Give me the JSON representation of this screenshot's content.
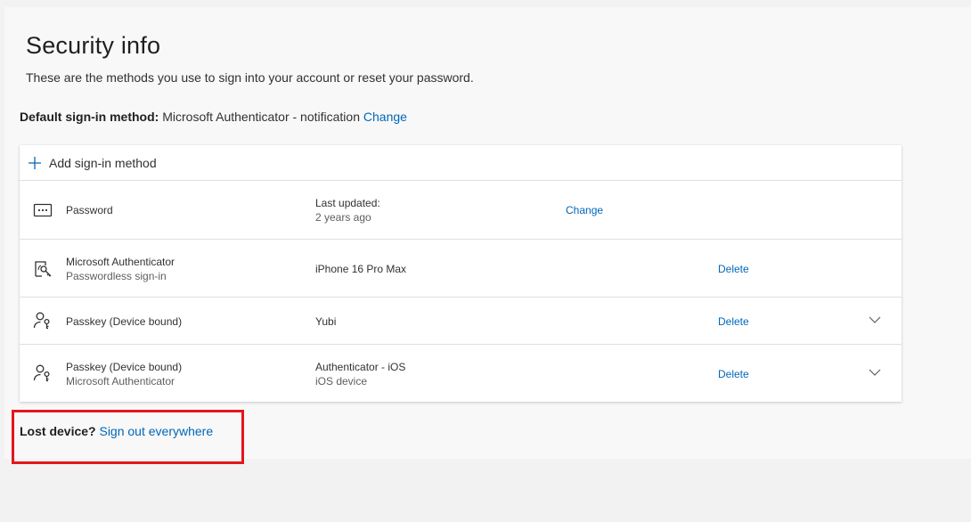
{
  "header": {
    "title": "Security info",
    "subtitle": "These are the methods you use to sign into your account or reset your password."
  },
  "default_method": {
    "label": "Default sign-in method:",
    "value": "Microsoft Authenticator - notification",
    "change_label": "Change"
  },
  "add_method": {
    "label": "Add sign-in method",
    "icon": "plus-icon"
  },
  "methods": [
    {
      "icon": "password-icon",
      "name": "Password",
      "name_sub": "",
      "detail": "Last updated:",
      "detail_sub": "2 years ago",
      "action": "Change",
      "expandable": false
    },
    {
      "icon": "authenticator-icon",
      "name": "Microsoft Authenticator",
      "name_sub": "Passwordless sign-in",
      "detail": "iPhone 16 Pro Max",
      "detail_sub": "",
      "action": "Delete",
      "expandable": false
    },
    {
      "icon": "passkey-icon",
      "name": "Passkey (Device bound)",
      "name_sub": "",
      "detail": "Yubi",
      "detail_sub": "",
      "action": "Delete",
      "expandable": true
    },
    {
      "icon": "passkey-icon",
      "name": "Passkey (Device bound)",
      "name_sub": "Microsoft Authenticator",
      "detail": "Authenticator - iOS",
      "detail_sub": "iOS device",
      "action": "Delete",
      "expandable": true
    }
  ],
  "lost_device": {
    "label": "Lost device?",
    "link": "Sign out everywhere"
  },
  "colors": {
    "link": "#0067b8",
    "highlight": "#e3161e"
  }
}
